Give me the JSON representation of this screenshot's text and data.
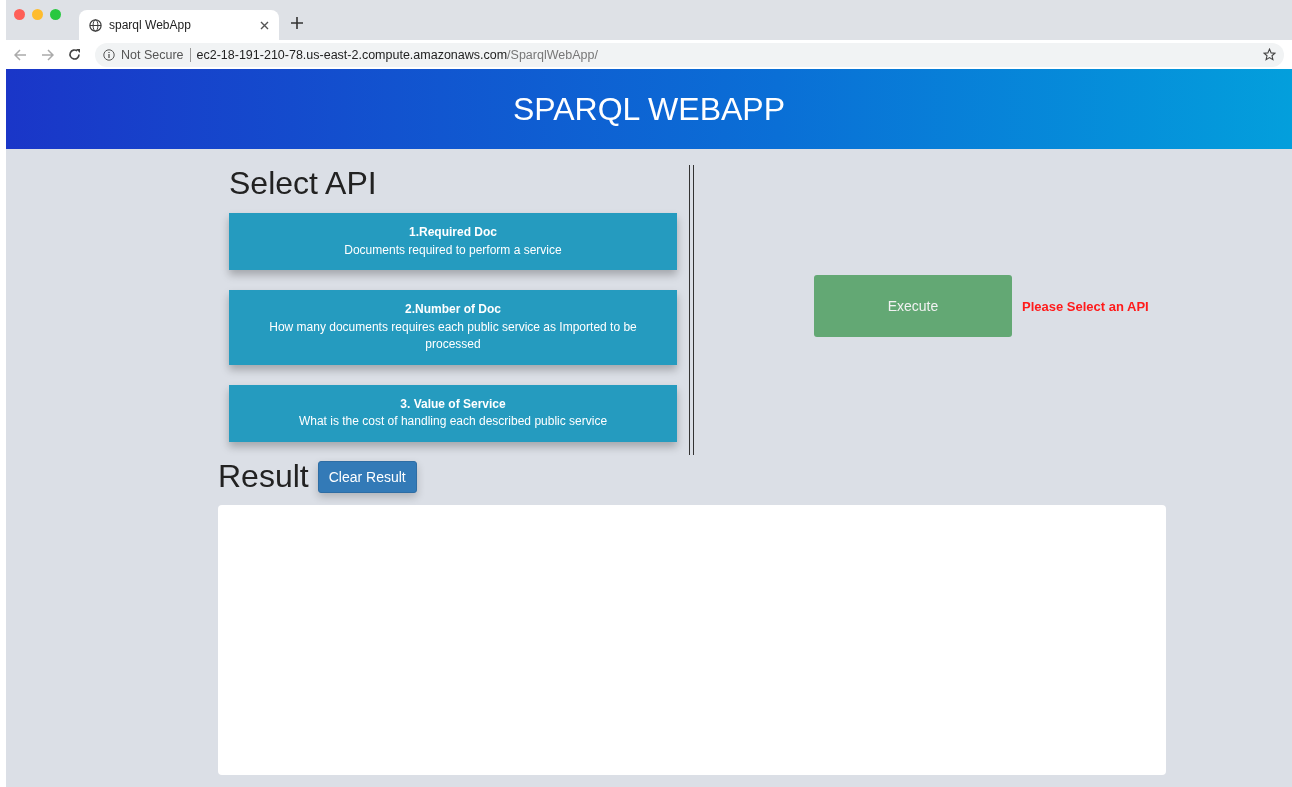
{
  "browser": {
    "tab_title": "sparql WebApp",
    "security": "Not Secure",
    "url_host": "ec2-18-191-210-78.us-east-2.compute.amazonaws.com",
    "url_path": "/SparqlWebApp/"
  },
  "header": {
    "title": "SPARQL WEBAPP"
  },
  "select_api": {
    "heading": "Select API",
    "options": [
      {
        "title": "1.Required Doc",
        "description": "Documents required to perform a service"
      },
      {
        "title": "2.Number of Doc",
        "description": "How many documents requires each public service as Imported to be processed"
      },
      {
        "title": "3. Value of Service",
        "description": "What is the cost of handling each described public service"
      }
    ]
  },
  "execute": {
    "button": "Execute",
    "message": "Please Select an API"
  },
  "result": {
    "heading": "Result",
    "clear_button": "Clear Result"
  }
}
